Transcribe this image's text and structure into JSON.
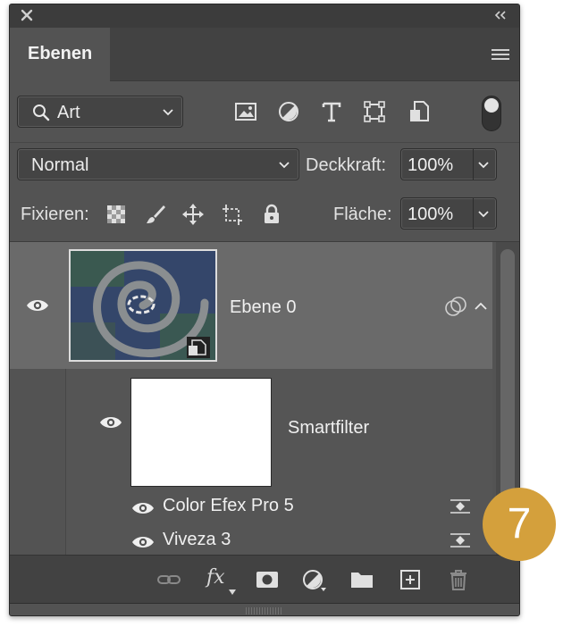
{
  "panel": {
    "tab_label": "Ebenen",
    "filter": {
      "label": "Art"
    },
    "blend_mode": "Normal",
    "opacity": {
      "label": "Deckkraft:",
      "value": "100%"
    },
    "lock_label": "Fixieren:",
    "fill": {
      "label": "Fläche:",
      "value": "100%"
    }
  },
  "layers": [
    {
      "name": "Ebene 0",
      "visible": true,
      "type": "smart-object",
      "smart_filters": {
        "label": "Smartfilter",
        "filters": [
          {
            "name": "Color Efex Pro 5",
            "visible": true
          },
          {
            "name": "Viveza 3",
            "visible": true
          }
        ]
      }
    }
  ],
  "footer": {
    "fx_label": "fx"
  },
  "badge": {
    "number": "7",
    "color": "#d4a03c"
  },
  "colors": {
    "panel_bg": "#535353",
    "selected_layer": "#6a6a6a",
    "header_bg": "#424242"
  }
}
